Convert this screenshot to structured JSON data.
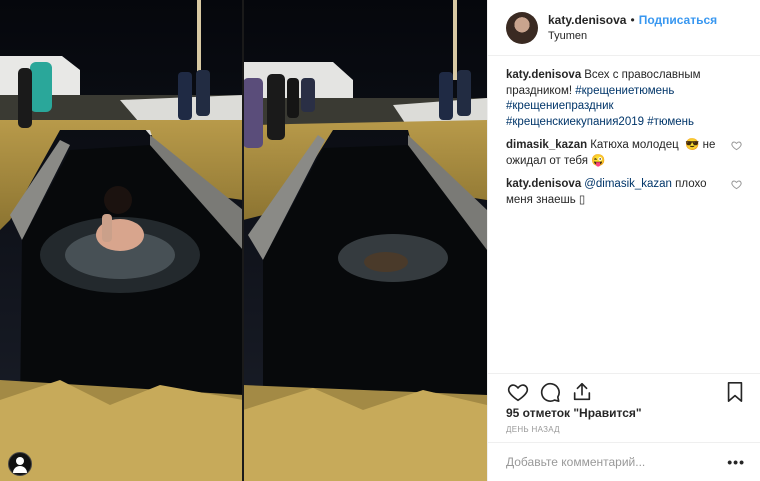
{
  "post": {
    "author": "katy.denisova",
    "separator": "•",
    "follow_label": "Подписаться",
    "location": "Tyumen"
  },
  "comments": [
    {
      "user": "katy.denisova",
      "text": "Всех с православным праздником!⁣⁣ ",
      "tags": "#крещениетюмень #крещениепраздник #крещенскиекупания2019 #тюмень",
      "liked": false
    },
    {
      "user": "dimasik_kazan",
      "text": "Катюха молодец ⁣⁣ 😎 не ожидал от тебя 😜",
      "tags": "",
      "liked": false
    },
    {
      "user": "katy.denisova",
      "mention": "@dimasik_kazan",
      "text": " плохо меня знаешь ▯",
      "liked": false
    }
  ],
  "likes_text": "95 отметок \"Нравится\"",
  "time_text": "ДЕНЬ НАЗАД",
  "add_comment_placeholder": "Добавьте комментарий...",
  "more_label": "•••",
  "icons": [
    "heart-icon",
    "comment-icon",
    "share-icon",
    "bookmark-icon",
    "profile-icon"
  ],
  "colors": {
    "link": "#3897f0",
    "hashtag": "#003569",
    "muted": "#999999",
    "border": "#efefef"
  }
}
